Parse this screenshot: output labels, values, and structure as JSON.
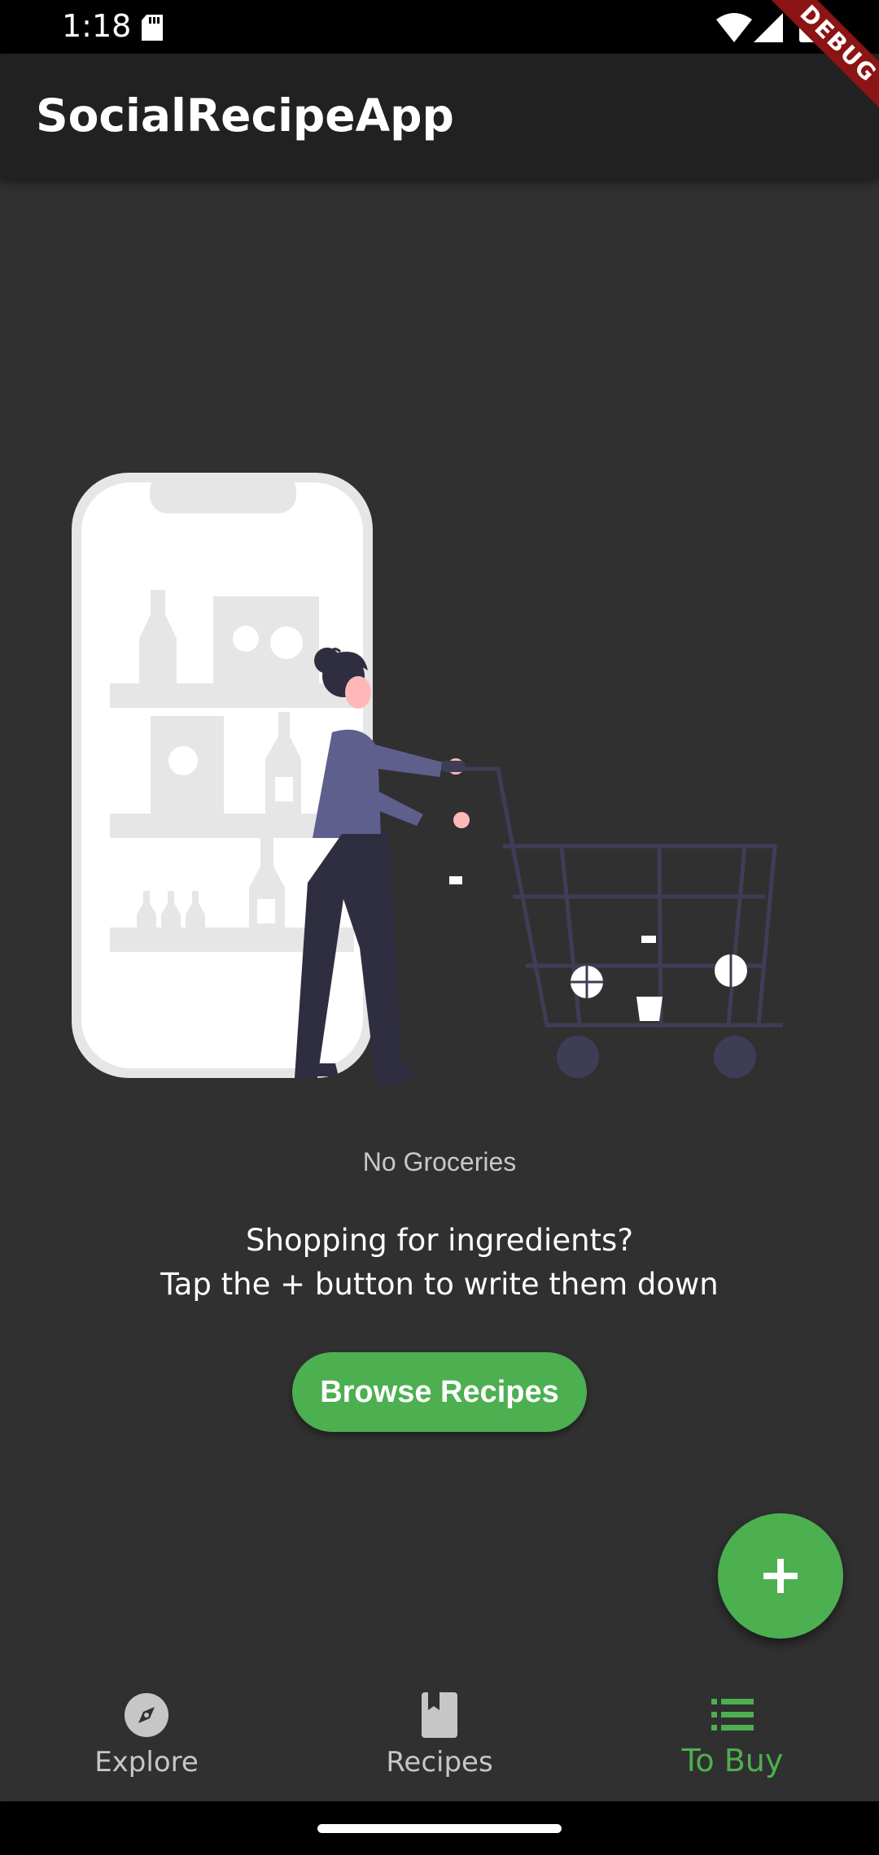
{
  "status_bar": {
    "time": "1:18",
    "icons": [
      "sd-card-icon",
      "wifi-icon",
      "signal-icon",
      "battery-icon"
    ]
  },
  "debug_banner": "DEBUG",
  "app_bar": {
    "title": "SocialRecipeApp"
  },
  "empty_state": {
    "title": "No Groceries",
    "message_line1": "Shopping for ingredients?",
    "message_line2": "Tap the + button to write them down",
    "button_label": "Browse Recipes"
  },
  "fab": {
    "icon": "plus-icon"
  },
  "bottom_nav": {
    "items": [
      {
        "label": "Explore",
        "icon": "compass-icon",
        "active": false
      },
      {
        "label": "Recipes",
        "icon": "book-icon",
        "active": false
      },
      {
        "label": "To Buy",
        "icon": "list-icon",
        "active": true
      }
    ]
  },
  "colors": {
    "accent": "#4caf50",
    "background": "#303030",
    "app_bar": "#212121"
  }
}
